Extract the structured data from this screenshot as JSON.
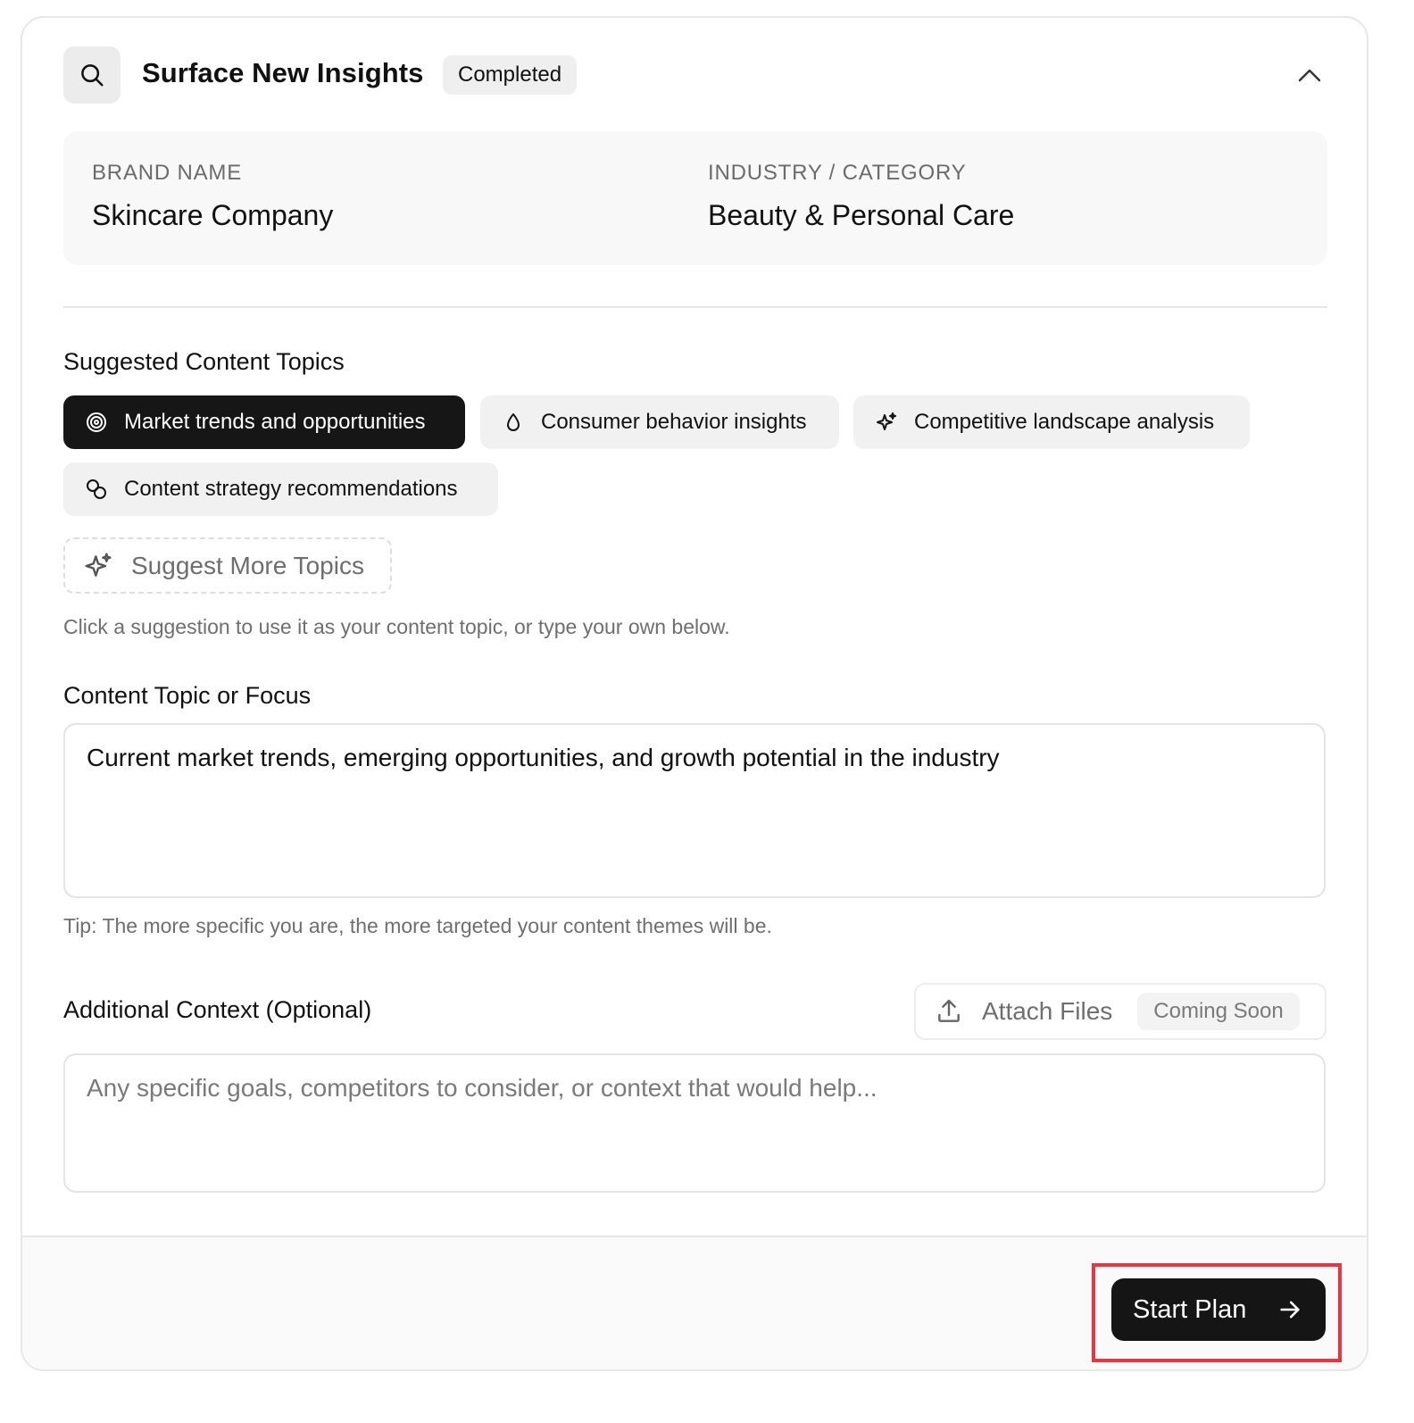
{
  "header": {
    "title": "Surface New Insights",
    "status": "Completed",
    "icon": "search-icon",
    "collapse_icon": "chevron-up-icon"
  },
  "brand": {
    "brand_label": "BRAND NAME",
    "brand_value": "Skincare Company",
    "industry_label": "INDUSTRY / CATEGORY",
    "industry_value": "Beauty & Personal Care"
  },
  "topics": {
    "title": "Suggested Content Topics",
    "chips": [
      {
        "label": "Market trends and opportunities",
        "icon": "target-icon",
        "selected": true
      },
      {
        "label": "Consumer behavior insights",
        "icon": "droplet-icon",
        "selected": false
      },
      {
        "label": "Competitive landscape analysis",
        "icon": "sparkle-icon",
        "selected": false
      },
      {
        "label": "Content strategy recommendations",
        "icon": "coins-icon",
        "selected": false
      }
    ],
    "suggest_more": "Suggest More Topics",
    "hint": "Click a suggestion to use it as your content topic, or type your own below."
  },
  "focus": {
    "label": "Content Topic or Focus",
    "value": "Current market trends, emerging opportunities, and growth potential in the industry",
    "tip": "Tip: The more specific you are, the more targeted your content themes will be."
  },
  "context": {
    "label": "Additional Context (Optional)",
    "placeholder": "Any specific goals, competitors to consider, or context that would help...",
    "attach_label": "Attach Files",
    "attach_badge": "Coming Soon"
  },
  "footer": {
    "start_label": "Start Plan"
  },
  "colors": {
    "accent_dark": "#151515",
    "highlight": "#ee3340"
  }
}
